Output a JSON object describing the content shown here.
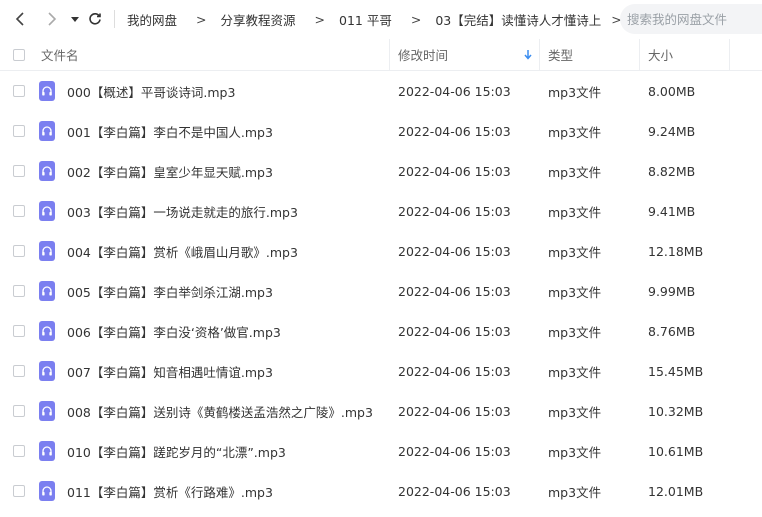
{
  "breadcrumb": [
    "我的网盘",
    "分享教程资源",
    "011 平哥",
    "03【完结】读懂诗人才懂诗上"
  ],
  "breadcrumb_sep": ">",
  "search": {
    "placeholder": "搜索我的网盘文件"
  },
  "columns": {
    "name": "文件名",
    "modified": "修改时间",
    "type": "类型",
    "size": "大小"
  },
  "icons": {
    "back": "chevron-left-icon",
    "forward": "chevron-right-icon",
    "history": "caret-down-icon",
    "refresh": "refresh-icon",
    "sort": "sort-down-arrow-icon",
    "file": "audio-file-icon"
  },
  "colors": {
    "file_icon": "#7b7ff0",
    "sort_arrow": "#3b8df0"
  },
  "files": [
    {
      "name": "000【概述】平哥谈诗词.mp3",
      "modified": "2022-04-06 15:03",
      "type": "mp3文件",
      "size": "8.00MB"
    },
    {
      "name": "001【李白篇】李白不是中国人.mp3",
      "modified": "2022-04-06 15:03",
      "type": "mp3文件",
      "size": "9.24MB"
    },
    {
      "name": "002【李白篇】皇室少年显天赋.mp3",
      "modified": "2022-04-06 15:03",
      "type": "mp3文件",
      "size": "8.82MB"
    },
    {
      "name": "003【李白篇】一场说走就走的旅行.mp3",
      "modified": "2022-04-06 15:03",
      "type": "mp3文件",
      "size": "9.41MB"
    },
    {
      "name": "004【李白篇】赏析《峨眉山月歌》.mp3",
      "modified": "2022-04-06 15:03",
      "type": "mp3文件",
      "size": "12.18MB"
    },
    {
      "name": "005【李白篇】李白举剑杀江湖.mp3",
      "modified": "2022-04-06 15:03",
      "type": "mp3文件",
      "size": "9.99MB"
    },
    {
      "name": "006【李白篇】李白没‘资格’做官.mp3",
      "modified": "2022-04-06 15:03",
      "type": "mp3文件",
      "size": "8.76MB"
    },
    {
      "name": "007【李白篇】知音相遇吐情谊.mp3",
      "modified": "2022-04-06 15:03",
      "type": "mp3文件",
      "size": "15.45MB"
    },
    {
      "name": "008【李白篇】送别诗《黄鹤楼送孟浩然之广陵》.mp3",
      "modified": "2022-04-06 15:03",
      "type": "mp3文件",
      "size": "10.32MB"
    },
    {
      "name": "010【李白篇】蹉跎岁月的“北漂”.mp3",
      "modified": "2022-04-06 15:03",
      "type": "mp3文件",
      "size": "10.61MB"
    },
    {
      "name": "011【李白篇】赏析《行路难》.mp3",
      "modified": "2022-04-06 15:03",
      "type": "mp3文件",
      "size": "12.01MB"
    }
  ]
}
